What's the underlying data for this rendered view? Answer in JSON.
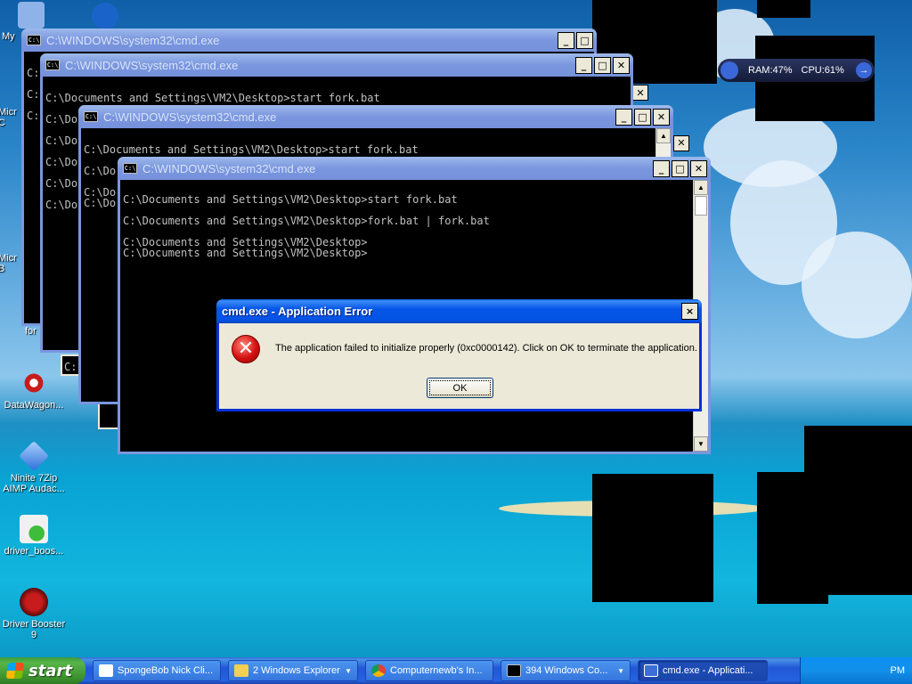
{
  "desktop": {
    "icons": [
      {
        "label": "My",
        "color": "#8fb3e8"
      },
      {
        "label": "Micr\nC",
        "color": "#3a6fd8"
      },
      {
        "label": "Micr\nB",
        "color": "#3a6fd8"
      },
      {
        "label": "for",
        "color": "#f1f1f1"
      },
      {
        "label": "DataWagon...",
        "color": "#c81c1c"
      },
      {
        "label": "Ninite 7Zip\nAIMP Audac...",
        "color": "#4a86e8"
      },
      {
        "label": "driver_boos...",
        "color": "#f0f0f0"
      },
      {
        "label": "Driver Booster\n9",
        "color": "#b01515"
      }
    ]
  },
  "gadget": {
    "ram": "RAM:47%",
    "cpu": "CPU:61%",
    "arrow": "→"
  },
  "windows": [
    {
      "title": "C:\\WINDOWS\\system32\\cmd.exe",
      "lines": [
        "",
        "C:",
        "",
        "C:",
        "",
        "C:"
      ]
    },
    {
      "title": "C:\\WINDOWS\\system32\\cmd.exe",
      "lines": [
        "",
        "C:\\Documents and Settings\\VM2\\Desktop>start fork.bat",
        "",
        "C:\\Do",
        "",
        "C:\\Do",
        "",
        "C:\\Do",
        "",
        "C:\\Do",
        "",
        "C:\\Do"
      ]
    },
    {
      "title": "C:\\WINDOWS\\system32\\cmd.exe",
      "lines": [
        "",
        "C:\\Documents and Settings\\VM2\\Desktop>start fork.bat",
        "",
        "C:\\Do",
        "",
        "C:\\Do",
        "C:\\Do"
      ]
    },
    {
      "title": "C:\\WINDOWS\\system32\\cmd.exe",
      "lines": [
        "C:\\Documents and Settings\\VM2\\Desktop>start fork.bat",
        "",
        "C:\\Documents and Settings\\VM2\\Desktop>fork.bat | fork.bat",
        "",
        "C:\\Documents and Settings\\VM2\\Desktop>",
        "C:\\Documents and Settings\\VM2\\Desktop>"
      ]
    }
  ],
  "stray_console_text": "C:",
  "error_dialog": {
    "title": "cmd.exe - Application Error",
    "close": "×",
    "icon_glyph": "✕",
    "message": "The application failed to initialize properly (0xc0000142). Click on OK to terminate the application.",
    "ok": "OK"
  },
  "window_buttons": {
    "minimize": "_",
    "maximize": "□",
    "close": "✕"
  },
  "console_icon_text": "C:\\",
  "taskbar": {
    "start": "start",
    "items": [
      {
        "label": "SpongeBob Nick Cli...",
        "color": "#ffffff"
      },
      {
        "label": "2 Windows Explorer",
        "color": "#f3cf54"
      },
      {
        "label": "Computernewb's In...",
        "color": "#e8a03a"
      },
      {
        "label": "394 Windows Co...",
        "color": "#000000"
      },
      {
        "label": "cmd.exe - Applicati...",
        "color": "#3b6fd6"
      }
    ],
    "tray_time": "PM"
  }
}
